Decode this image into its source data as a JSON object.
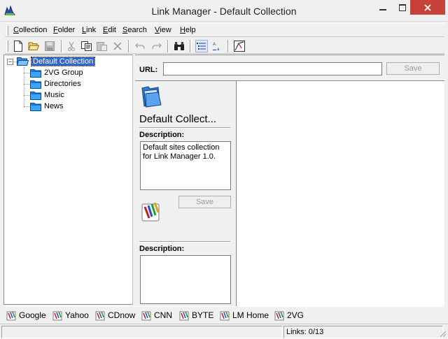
{
  "window": {
    "title": "Link Manager - Default Collection",
    "icon": "link-manager-app-icon",
    "controls": [
      "minimize-icon",
      "maximize-icon",
      "close-icon"
    ]
  },
  "menubar": {
    "items": [
      {
        "label": "Collection",
        "accel": "C"
      },
      {
        "label": "Folder",
        "accel": "F"
      },
      {
        "label": "Link",
        "accel": "L"
      },
      {
        "label": "Edit",
        "accel": "E"
      },
      {
        "label": "Search",
        "accel": "S"
      },
      {
        "label": "View",
        "accel": "V"
      },
      {
        "label": "Help",
        "accel": "H"
      }
    ]
  },
  "toolbar": {
    "buttons": [
      {
        "icon": "new-icon",
        "enabled": true
      },
      {
        "icon": "open-folder-icon",
        "enabled": true
      },
      {
        "icon": "save-icon",
        "enabled": false
      },
      {
        "icon": "cut-icon",
        "enabled": false
      },
      {
        "icon": "copy-icon",
        "enabled": true
      },
      {
        "icon": "paste-icon",
        "enabled": false
      },
      {
        "icon": "delete-icon",
        "enabled": false
      },
      {
        "icon": "undo-icon",
        "enabled": false
      },
      {
        "icon": "redo-icon",
        "enabled": false
      },
      {
        "icon": "find-binoculars-icon",
        "enabled": true
      },
      {
        "icon": "details-view-icon",
        "enabled": true,
        "pressed": true
      },
      {
        "icon": "sort-view-icon",
        "enabled": true
      },
      {
        "icon": "properties-icon",
        "enabled": true
      }
    ]
  },
  "tree": {
    "root": {
      "label": "Default Collection",
      "expanded": true,
      "selected": true,
      "icon": "folder-open-icon"
    },
    "children": [
      {
        "label": "2VG Group",
        "icon": "folder-icon"
      },
      {
        "label": "Directories",
        "icon": "folder-icon"
      },
      {
        "label": "Music",
        "icon": "folder-icon"
      },
      {
        "label": "News",
        "icon": "folder-icon"
      }
    ]
  },
  "url_bar": {
    "label": "URL:",
    "value": "",
    "save_label": "Save"
  },
  "info_panel": {
    "collection_name": "Default Collect...",
    "description_label": "Description:",
    "description_text": "Default sites collection for Link Manager 1.0.",
    "save_label": "Save",
    "link_description_label": "Description:",
    "link_description_text": ""
  },
  "quick_links": [
    {
      "label": "Google"
    },
    {
      "label": "Yahoo"
    },
    {
      "label": "CDnow"
    },
    {
      "label": "CNN"
    },
    {
      "label": "BYTE"
    },
    {
      "label": "LM Home"
    },
    {
      "label": "2VG"
    }
  ],
  "status": {
    "left": "",
    "links": "Links: 0/13"
  },
  "colors": {
    "selection": "#3366cc",
    "close_button": "#c7423a",
    "folder": "#1e90ff"
  }
}
